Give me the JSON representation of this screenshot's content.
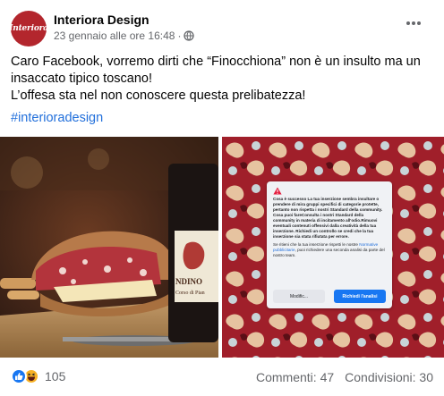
{
  "post": {
    "page_name": "Interiora Design",
    "avatar_text": "Interiora",
    "timestamp": "23 gennaio alle ore 16:48",
    "separator": "·",
    "text_lines": [
      "Caro Facebook, vorremo dirti che “Finocchiona” non è un insulto ma un",
      "insaccato tipico toscano!",
      "L’offesa sta nel non conoscere questa prelibatezza!"
    ],
    "hashtag": "#interioradesign"
  },
  "notice": {
    "body": "Cosa è successo La tua inserzione sembra insultare o prendere di mira gruppi specifici di categorie protette, pertanto non rispetta i nostri Standard della community. Cosa puoi fareConsulta i nostri Standard della community in materia di incitamento all'odio.Rimuovi eventuali contenuti offensivi dalla creatività della tua inserzione. Richiedi un controllo se credi che la tua inserzione sia stata rifiutata per errore.",
    "foot_before": "Se ritieni che la tua inserzione rispetti le nostre ",
    "foot_link": "Normative pubblicitarie",
    "foot_after": ", puoi richiedere una seconda analisi da parte del nostro team.",
    "modify_label": "Modific...",
    "request_label": "Richiedi l'analisi"
  },
  "wine_label": {
    "line1": "NDINO",
    "line2": "Corso di Pian"
  },
  "footer": {
    "reaction_count": "105",
    "comments": "Commenti: 47",
    "shares": "Condivisioni: 30"
  },
  "icons": {
    "globe": "globe-icon",
    "more": "more-options-icon",
    "like": "like-reaction-icon",
    "haha": "haha-reaction-icon",
    "warning": "warning-icon"
  },
  "colors": {
    "link": "#216fdb",
    "brand_red": "#b3262d",
    "pattern_red": "#a01f2a",
    "like_blue": "#1877f2",
    "haha_yellow": "#f7b125"
  }
}
